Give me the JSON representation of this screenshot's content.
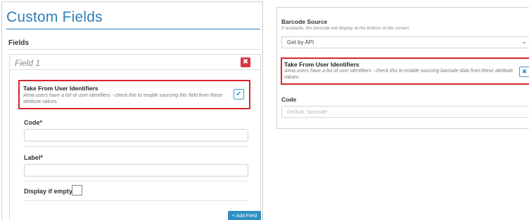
{
  "left": {
    "title": "Custom Fields",
    "fields_heading": "Fields",
    "field": {
      "title": "Field 1",
      "delete_glyph": "✖",
      "user_identifiers": {
        "title": "Take From User Identifiers",
        "description": "Alma users have a list of user identifiers - check this to enable sourcing this field from these attribute values.",
        "checked": true,
        "check_glyph": "✔"
      },
      "code_label": "Code*",
      "code_value": "",
      "label_label": "Label*",
      "label_value": "",
      "display_if_empty_label": "Display if empty",
      "display_if_empty_checked": false
    },
    "add_field_label": "+ Add Field"
  },
  "right": {
    "barcode_source_label": "Barcode Source",
    "barcode_source_hint": "If available, the barcode will display at the bottom of the screen.",
    "barcode_source_value": "Get by API",
    "chevron_glyph": "⌄",
    "user_identifiers": {
      "title": "Take From User Identifiers",
      "description": "Alma users have a list of user identifiers - check this to enable sourcing barcode data from these attribute values.",
      "checked": false,
      "check_glyph": "✖"
    },
    "code_label": "Code",
    "code_placeholder": "Default: 'barcode'"
  },
  "colors": {
    "title_blue": "#2e7fb8",
    "highlight_red": "#d9252e",
    "delete_red": "#d9343f",
    "button_blue": "#2d8fc4",
    "checkbox_blue": "#3a9bd0"
  },
  "icons": {
    "delete": "close-icon",
    "check": "checkmark-icon",
    "uncheck": "x-mark-icon",
    "dropdown": "chevron-down-icon"
  }
}
